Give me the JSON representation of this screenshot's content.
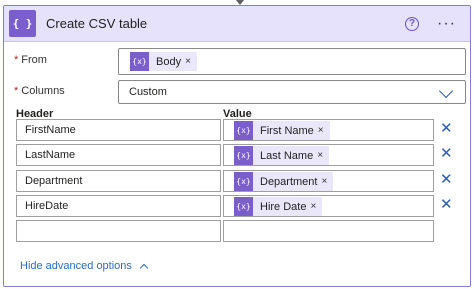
{
  "header": {
    "icon_glyph": "{ }",
    "title": "Create CSV table",
    "help_glyph": "?",
    "more_glyph": "···"
  },
  "from": {
    "label": "From",
    "required_mark": "*",
    "token": {
      "label": "Body",
      "icon": "expression-icon",
      "remove": "×"
    }
  },
  "columns": {
    "label": "Columns",
    "required_mark": "*",
    "value": "Custom"
  },
  "table": {
    "header_label": "Header",
    "value_label": "Value",
    "rows": [
      {
        "header": "FirstName",
        "value": "First Name"
      },
      {
        "header": "LastName",
        "value": "Last Name"
      },
      {
        "header": "Department",
        "value": "Department"
      },
      {
        "header": "HireDate",
        "value": "Hire Date"
      },
      {
        "header": "",
        "value": ""
      }
    ],
    "token_remove": "×",
    "row_delete": "✕"
  },
  "footer": {
    "advanced_label": "Hide advanced options"
  },
  "colors": {
    "accent": "#7a5ecc",
    "titlebar": "#e6e2fb",
    "link": "#2b6cc4"
  }
}
